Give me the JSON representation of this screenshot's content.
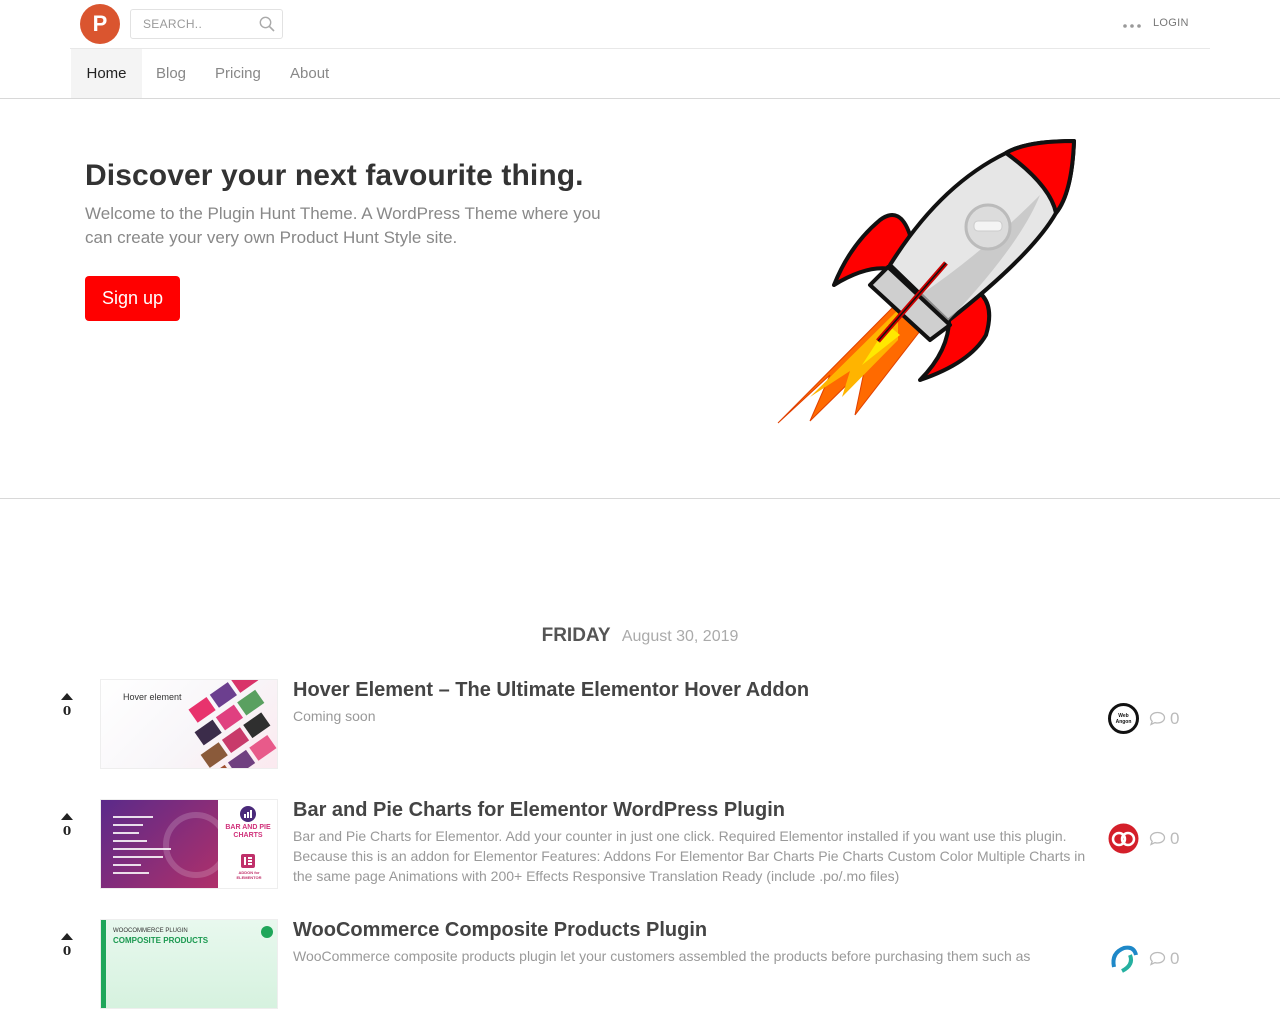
{
  "header": {
    "logo_letter": "P",
    "search_placeholder": "SEARCH..",
    "login_label": "LOGIN",
    "brand_color": "#da552f"
  },
  "nav": {
    "items": [
      {
        "label": "Home",
        "active": true
      },
      {
        "label": "Blog",
        "active": false
      },
      {
        "label": "Pricing",
        "active": false
      },
      {
        "label": "About",
        "active": false
      }
    ]
  },
  "hero": {
    "title": "Discover your next favourite thing.",
    "subtitle": "Welcome to the Plugin Hunt Theme. A WordPress Theme where you can create your very own Product Hunt Style site.",
    "signup_label": "Sign up",
    "accent_color": "#ff0000"
  },
  "day": {
    "name": "FRIDAY",
    "date": "August 30, 2019"
  },
  "posts": [
    {
      "votes": "0",
      "title": "Hover Element – The Ultimate Elementor Hover Addon",
      "description": "Coming soon",
      "thumb_label": "Hover element",
      "avatar_text": "Web Angon",
      "comments": "0"
    },
    {
      "votes": "0",
      "title": "Bar and Pie Charts for Elementor WordPress Plugin",
      "description": "Bar and Pie Charts for Elementor. Add your counter in just one click. Required Elementor installed if you want use this plugin. Because this is an addon for Elementor Features: Addons For Elementor Bar Charts Pie Charts Custom Color Multiple Charts in the same page Animations with 200+ Effects Responsive Translation Ready (include .po/.mo files)",
      "thumb_label": "BAR AND PIE CHARTS",
      "thumb_label2": "ADDON for ELEMENTOR",
      "avatar_text": "",
      "comments": "0"
    },
    {
      "votes": "0",
      "title": "WooCommerce Composite Products Plugin",
      "description": "WooCommerce composite products plugin let your customers assembled the products before purchasing them such as",
      "thumb_label": "WOOCOMMERCE PLUGIN",
      "thumb_label2": "COMPOSITE PRODUCTS",
      "avatar_text": "",
      "comments": "0"
    }
  ]
}
